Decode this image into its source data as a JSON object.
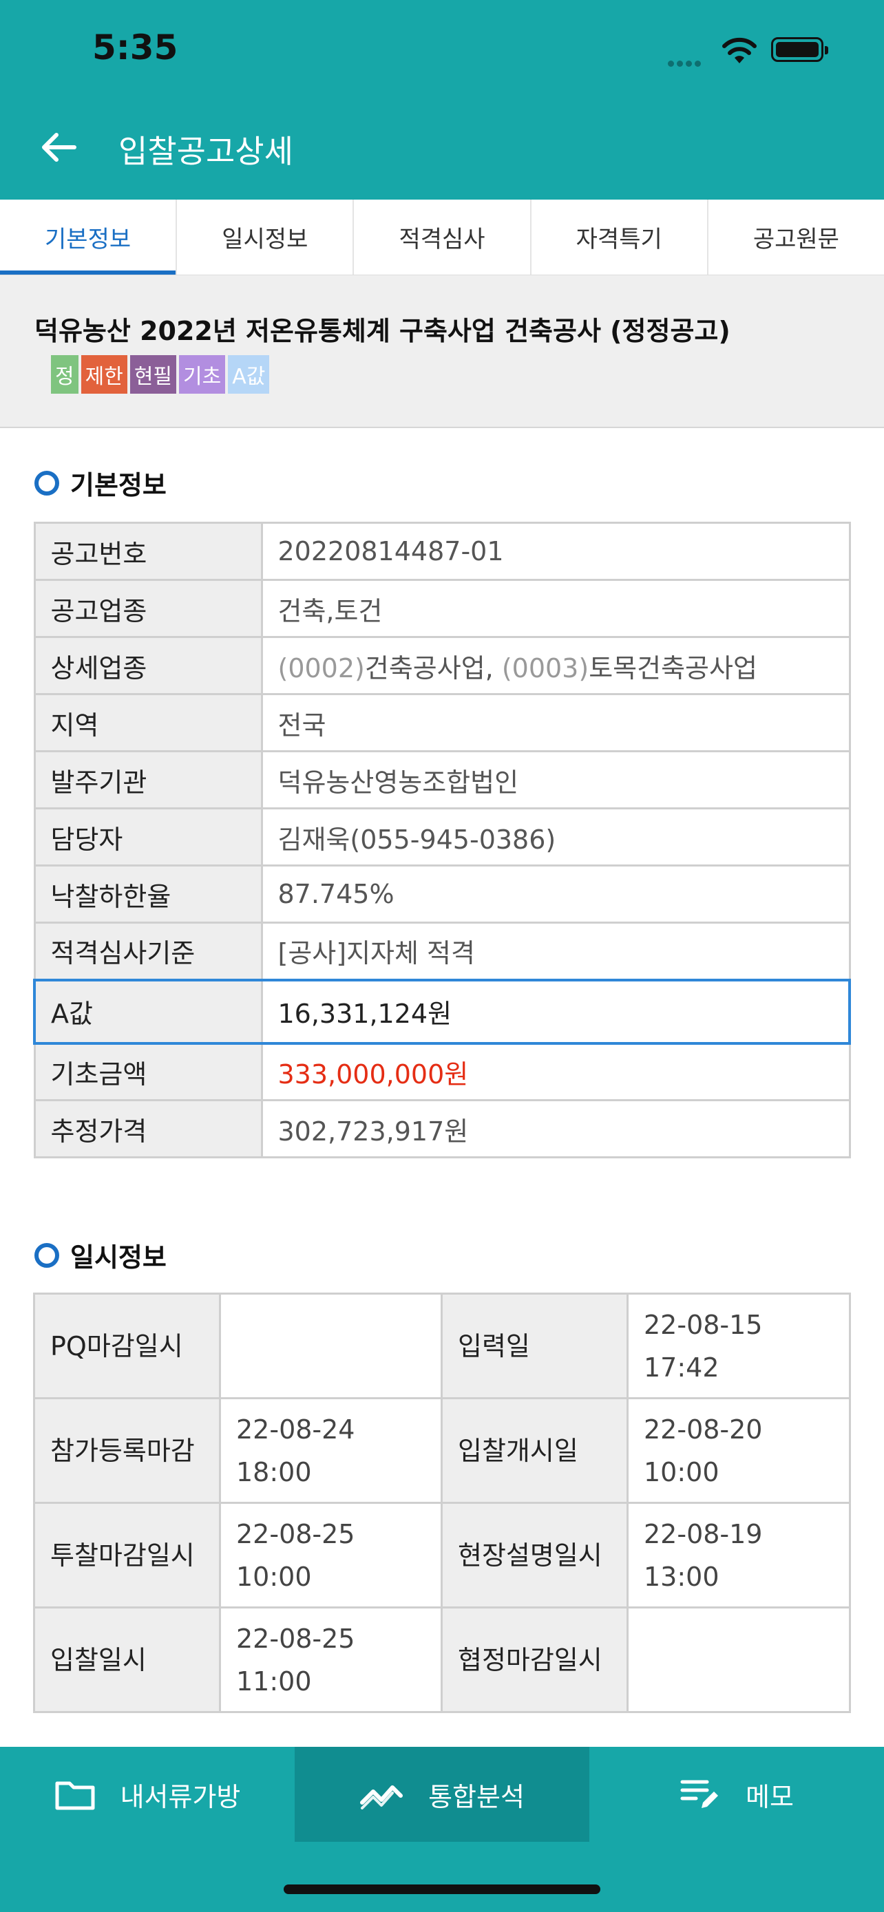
{
  "status": {
    "time": "5:35"
  },
  "header": {
    "title": "입찰공고상세"
  },
  "tabs": [
    "기본정보",
    "일시정보",
    "적격심사",
    "자격특기",
    "공고원문"
  ],
  "notice": {
    "title": "덕유농산 2022년 저온유통체계 구축사업 건축공사 (정정공고)",
    "badges": [
      {
        "label": "정",
        "color": "#7fc47f"
      },
      {
        "label": "제한",
        "color": "#e2623c"
      },
      {
        "label": "현필",
        "color": "#8b5f98"
      },
      {
        "label": "기초",
        "color": "#b28ee0"
      },
      {
        "label": "A값",
        "color": "#b5d6f7"
      }
    ]
  },
  "basic_info": {
    "section_title": "기본정보",
    "rows": [
      {
        "label": "공고번호",
        "value": "20220814487-01"
      },
      {
        "label": "공고업종",
        "value": "건축,토건"
      },
      {
        "label": "상세업종",
        "code1": "(0002)",
        "name1": "건축공사업, ",
        "code2": "(0003)",
        "name2": "토목건축공사업"
      },
      {
        "label": "지역",
        "value": "전국"
      },
      {
        "label": "발주기관",
        "value": "덕유농산영농조합법인"
      },
      {
        "label": "담당자",
        "value": "김재욱(055-945-0386)"
      },
      {
        "label": "낙찰하한율",
        "value": "87.745%"
      },
      {
        "label": "적격심사기준",
        "value": "[공사]지자체 적격"
      },
      {
        "label": "A값",
        "value": "16,331,124원"
      },
      {
        "label": "기초금액",
        "value": "333,000,000원",
        "color": "#e52d14"
      },
      {
        "label": "추정가격",
        "value": "302,723,917원"
      }
    ]
  },
  "schedule_info": {
    "section_title": "일시정보",
    "rows": [
      {
        "label_a": "PQ마감일시",
        "value_a_date": "",
        "value_a_time": "",
        "label_b": "입력일",
        "value_b_date": "22-08-15",
        "value_b_time": "17:42"
      },
      {
        "label_a": "참가등록마감",
        "value_a_date": "22-08-24",
        "value_a_time": "18:00",
        "label_b": "입찰개시일",
        "value_b_date": "22-08-20",
        "value_b_time": "10:00"
      },
      {
        "label_a": "투찰마감일시",
        "value_a_date": "22-08-25",
        "value_a_time": "10:00",
        "label_b": "현장설명일시",
        "value_b_date": "22-08-19",
        "value_b_time": "13:00"
      },
      {
        "label_a": "입찰일시",
        "value_a_date": "22-08-25",
        "value_a_time": "11:00",
        "label_b": "협정마감일시",
        "value_b_date": "",
        "value_b_time": ""
      }
    ]
  },
  "bottom_nav": [
    {
      "label": "내서류가방",
      "icon": "folder-icon"
    },
    {
      "label": "통합분석",
      "icon": "analysis-icon"
    },
    {
      "label": "메모",
      "icon": "memo-icon"
    }
  ]
}
